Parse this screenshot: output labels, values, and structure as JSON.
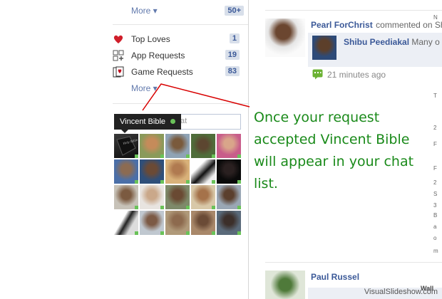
{
  "sidebar": {
    "top_more": {
      "label": "More ▾",
      "count": "50+"
    },
    "items": [
      {
        "label": "Top Loves",
        "count": "1",
        "icon": "heart-icon"
      },
      {
        "label": "App Requests",
        "count": "19",
        "icon": "app-requests-icon"
      },
      {
        "label": "Game Requests",
        "count": "83",
        "icon": "game-requests-icon"
      }
    ],
    "bottom_more": {
      "label": "More ▾"
    }
  },
  "chat": {
    "tooltip": {
      "name": "Vincent Bible",
      "status_color": "#6ac259"
    },
    "search": {
      "value": "at"
    },
    "online_color": "#6ac259"
  },
  "feed": {
    "post1": {
      "author": "Pearl ForChrist",
      "action": "commented on Sh",
      "commenter": "Shibu Peediakal",
      "commenter_text": "Many o",
      "time": "21 minutes ago"
    },
    "post2": {
      "author": "Paul Russel"
    }
  },
  "annotation": {
    "text": "Once your request accepted Vincent Bible will appear in your chat list.",
    "color": "#1a8a1a"
  },
  "watermark": {
    "text": "VisualSlideshow.com"
  },
  "right_fragments": [
    "N",
    "T",
    "2",
    "F",
    "F",
    "2",
    "S",
    "3",
    "B",
    "a",
    "o",
    "m",
    "Wall"
  ]
}
